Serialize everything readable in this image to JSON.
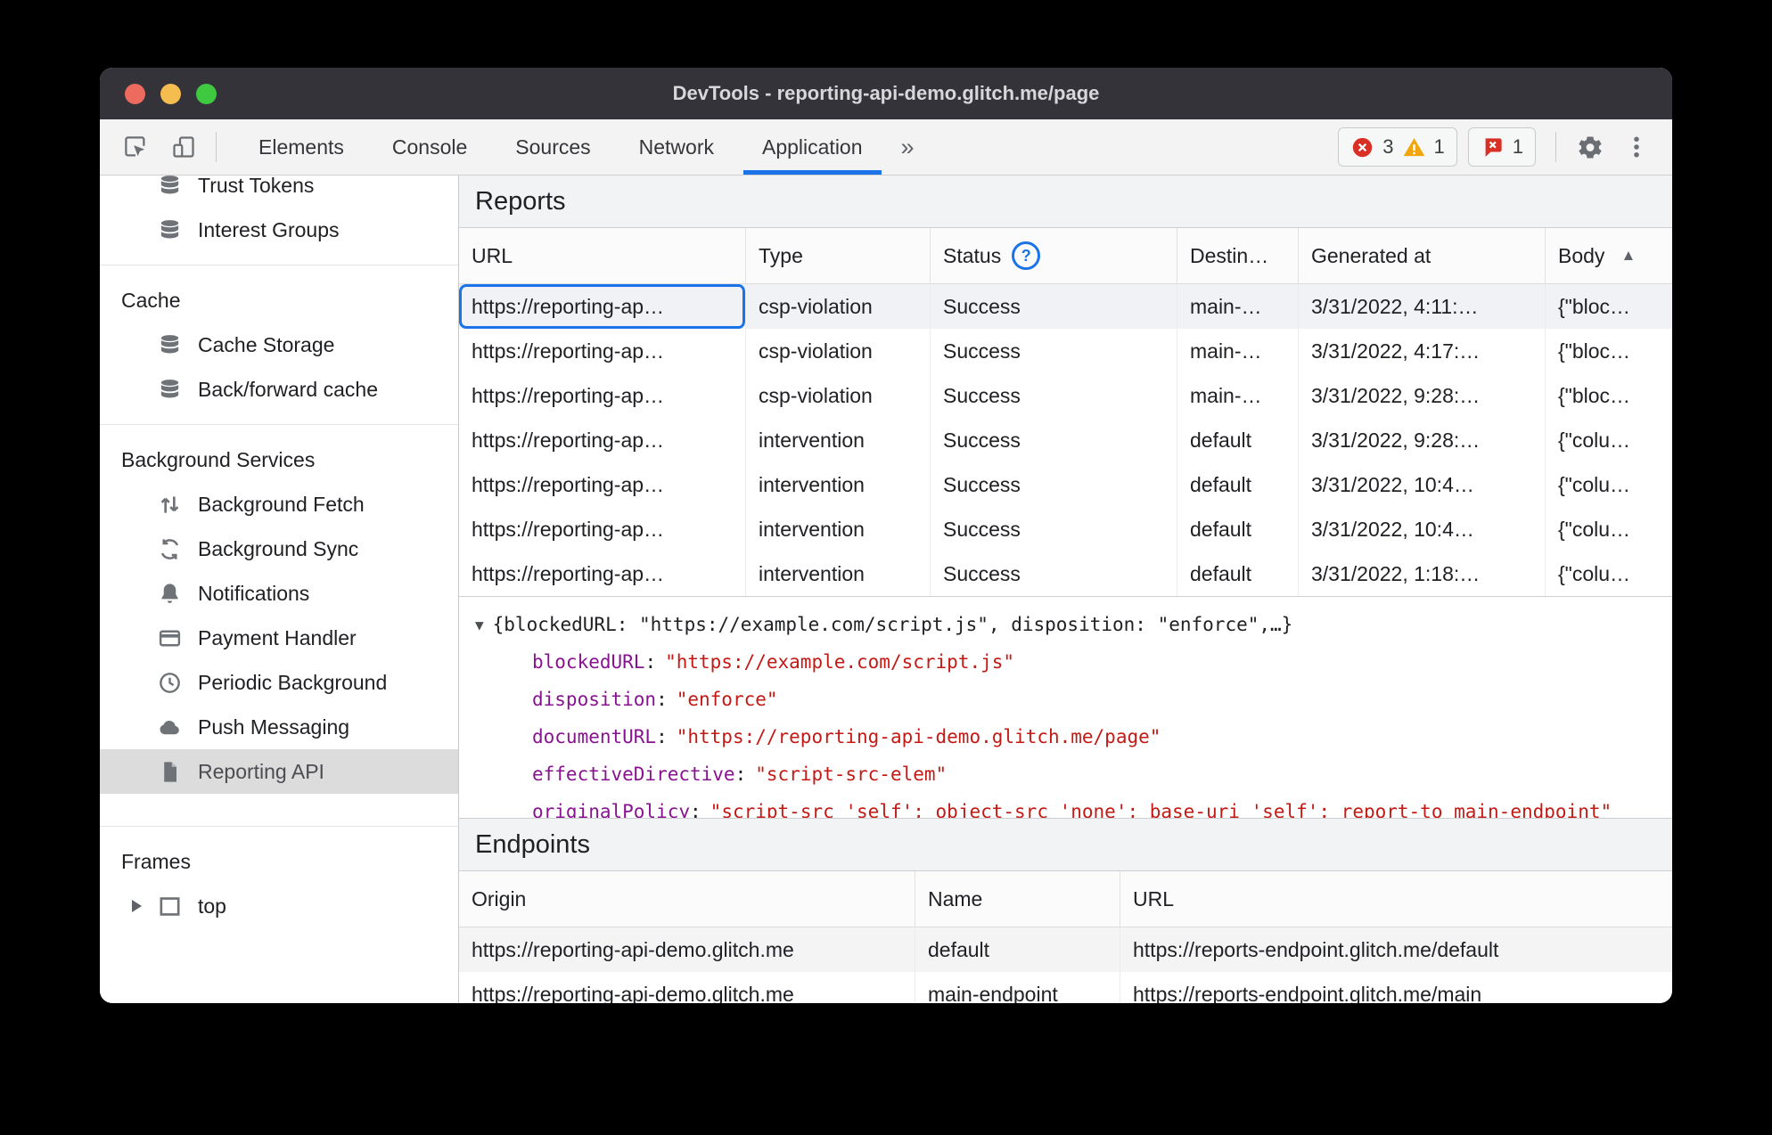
{
  "colors": {
    "accent": "#1a73e8",
    "titlebar-bg": "#34333a",
    "toolbar-bg": "#f3f3f3",
    "section-head-bg": "#f1f3f4",
    "error-red": "#d93025",
    "warning-yellow": "#f2a60d",
    "key-purple": "#881391",
    "value-red": "#c41a16",
    "selected-row-bg": "#f0f2f6",
    "sidebar-selected-bg": "#dcdcdd",
    "traffic-red": "#ed6a5e",
    "traffic-yellow": "#f5bd4f",
    "traffic-green": "#3ec941"
  },
  "window": {
    "title": "DevTools - reporting-api-demo.glitch.me/page"
  },
  "toolbar": {
    "tabs": [
      "Elements",
      "Console",
      "Sources",
      "Network",
      "Application"
    ],
    "more_tabs_glyph": "»",
    "error_count": "3",
    "warning_count": "1",
    "issue_count": "1"
  },
  "sidebar": {
    "top_items": [
      "Trust Tokens",
      "Interest Groups"
    ],
    "cache": {
      "title": "Cache",
      "items": [
        "Cache Storage",
        "Back/forward cache"
      ]
    },
    "background": {
      "title": "Background Services",
      "items": [
        "Background Fetch",
        "Background Sync",
        "Notifications",
        "Payment Handler",
        "Periodic Background",
        "Push Messaging",
        "Reporting API"
      ]
    },
    "frames": {
      "title": "Frames",
      "items": [
        "top"
      ]
    }
  },
  "reports": {
    "title": "Reports",
    "columns": {
      "url": "URL",
      "type": "Type",
      "status": "Status",
      "destination": "Destin…",
      "generated": "Generated at",
      "body": "Body"
    },
    "sort_glyph": "▲",
    "rows": [
      {
        "url": "https://reporting-ap…",
        "type": "csp-violation",
        "status": "Success",
        "destination": "main-…",
        "generated": "3/31/2022, 4:11:…",
        "body": "{\"bloc…"
      },
      {
        "url": "https://reporting-ap…",
        "type": "csp-violation",
        "status": "Success",
        "destination": "main-…",
        "generated": "3/31/2022, 4:17:…",
        "body": "{\"bloc…"
      },
      {
        "url": "https://reporting-ap…",
        "type": "csp-violation",
        "status": "Success",
        "destination": "main-…",
        "generated": "3/31/2022, 9:28:…",
        "body": "{\"bloc…"
      },
      {
        "url": "https://reporting-ap…",
        "type": "intervention",
        "status": "Success",
        "destination": "default",
        "generated": "3/31/2022, 9:28:…",
        "body": "{\"colu…"
      },
      {
        "url": "https://reporting-ap…",
        "type": "intervention",
        "status": "Success",
        "destination": "default",
        "generated": "3/31/2022, 10:4…",
        "body": "{\"colu…"
      },
      {
        "url": "https://reporting-ap…",
        "type": "intervention",
        "status": "Success",
        "destination": "default",
        "generated": "3/31/2022, 10:4…",
        "body": "{\"colu…"
      },
      {
        "url": "https://reporting-ap…",
        "type": "intervention",
        "status": "Success",
        "destination": "default",
        "generated": "3/31/2022, 1:18:…",
        "body": "{\"colu…"
      }
    ]
  },
  "details": {
    "caret": "▼",
    "preview": "{blockedURL: \"https://example.com/script.js\", disposition: \"enforce\",…}",
    "fields": [
      {
        "key": "blockedURL",
        "value": "\"https://example.com/script.js\""
      },
      {
        "key": "disposition",
        "value": "\"enforce\""
      },
      {
        "key": "documentURL",
        "value": "\"https://reporting-api-demo.glitch.me/page\""
      },
      {
        "key": "effectiveDirective",
        "value": "\"script-src-elem\""
      },
      {
        "key": "originalPolicy",
        "value": "\"script-src 'self'; object-src 'none'; base-uri 'self'; report-to main-endpoint\""
      }
    ]
  },
  "endpoints": {
    "title": "Endpoints",
    "columns": {
      "origin": "Origin",
      "name": "Name",
      "url": "URL"
    },
    "rows": [
      {
        "origin": "https://reporting-api-demo.glitch.me",
        "name": "default",
        "url": "https://reports-endpoint.glitch.me/default"
      },
      {
        "origin": "https://reporting-api-demo.glitch.me",
        "name": "main-endpoint",
        "url": "https://reports-endpoint.glitch.me/main"
      }
    ]
  }
}
